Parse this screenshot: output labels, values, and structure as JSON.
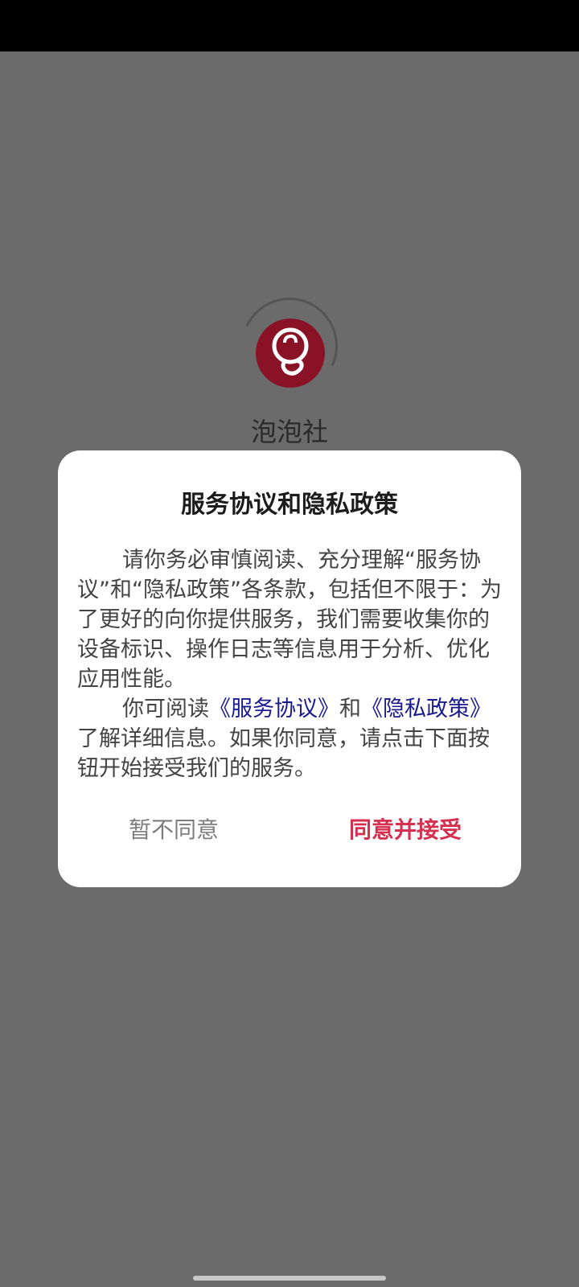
{
  "app": {
    "name": "泡泡社",
    "logo_icon": "bubble-logo-icon",
    "brand_color": "#8a1227"
  },
  "dialog": {
    "title": "服务协议和隐私政策",
    "paragraph1": "请你务必审慎阅读、充分理解“服务协议”和“隐私政策”各条款，包括但不限于：为了更好的向你提供服务，我们需要收集你的设备标识、操作日志等信息用于分析、优化应用性能。",
    "paragraph2_before": "你可阅读",
    "service_agreement_link": "《服务协议》",
    "paragraph2_and": "和",
    "privacy_policy_link": "《隐私政策》",
    "paragraph2_after": "了解详细信息。如果你同意，请点击下面按钮开始接受我们的服务。",
    "decline_label": "暂不同意",
    "accept_label": "同意并接受",
    "accept_color": "#d63050"
  }
}
